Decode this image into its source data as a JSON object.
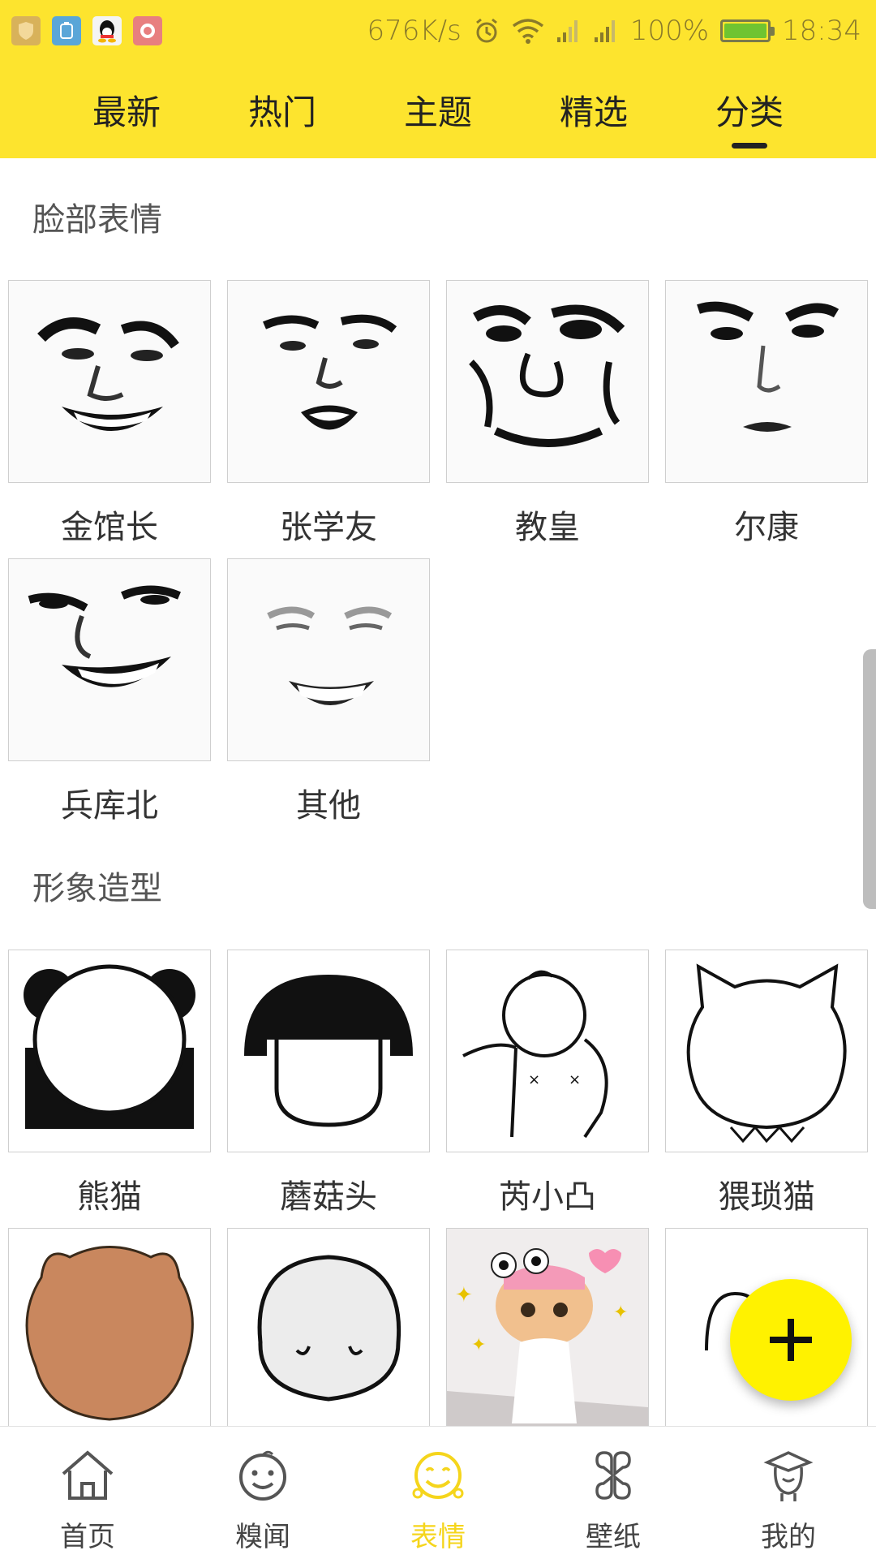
{
  "status_bar": {
    "net_speed": "676K/s",
    "battery": "100%",
    "time": "18:34",
    "app_icons": [
      "shield-app-icon",
      "tablet-app-icon",
      "qq-app-icon",
      "camera-app-icon"
    ]
  },
  "tabs": {
    "items": [
      "最新",
      "热门",
      "主题",
      "精选",
      "分类"
    ],
    "active_index": 4
  },
  "sections": [
    {
      "title": "脸部表情",
      "items": [
        {
          "label": "金馆长",
          "icon": "meme-face-jin-icon"
        },
        {
          "label": "张学友",
          "icon": "meme-face-zhang-icon"
        },
        {
          "label": "教皇",
          "icon": "meme-face-pope-icon"
        },
        {
          "label": "尔康",
          "icon": "meme-face-erkang-icon"
        },
        {
          "label": "兵库北",
          "icon": "meme-face-bingkubei-icon"
        },
        {
          "label": "其他",
          "icon": "meme-face-other-icon"
        }
      ]
    },
    {
      "title": "形象造型",
      "items": [
        {
          "label": "熊猫",
          "icon": "panda-head-icon"
        },
        {
          "label": "蘑菇头",
          "icon": "mushroom-head-icon"
        },
        {
          "label": "芮小凸",
          "icon": "rui-xiaotu-icon"
        },
        {
          "label": "猥琐猫",
          "icon": "wretched-cat-icon"
        }
      ]
    }
  ],
  "partial_row": [
    "brown-bear-icon",
    "white-blob-icon",
    "cat-photo-icon",
    "stick-figure-icon"
  ],
  "fab": {
    "icon": "plus-icon"
  },
  "bottom_nav": {
    "items": [
      {
        "label": "首页",
        "icon": "home-icon"
      },
      {
        "label": "糗闻",
        "icon": "smile-face-icon"
      },
      {
        "label": "表情",
        "icon": "emoji-icon"
      },
      {
        "label": "壁纸",
        "icon": "clover-grid-icon"
      },
      {
        "label": "我的",
        "icon": "profile-icon"
      }
    ],
    "active_index": 2
  },
  "colors": {
    "brand_yellow": "#FDE42E",
    "fab_yellow": "#FFF200",
    "active_nav": "#F5D51C"
  }
}
